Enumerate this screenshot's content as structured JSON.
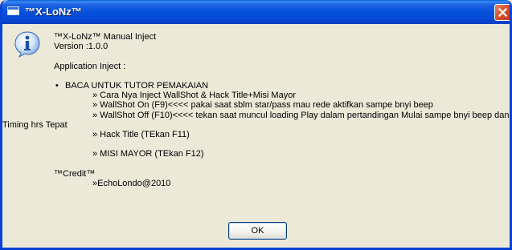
{
  "window": {
    "title": "™X-LoNz™"
  },
  "dialog": {
    "icon": "information-icon",
    "line_title": "™X-LoNz™ Manual Inject",
    "line_version": "Version :1.0.0",
    "line_app": "Application Inject :",
    "bullet": "BACA UNTUK TUTOR PEMAKAIAN",
    "item1": "» Cara Nya Inject WallShot & Hack Title+Misi Mayor",
    "item2": "» WallShot On (F9)<<<< pakai saat sblm star/pass mau rede aktifkan sampe bnyi beep",
    "item3a": "» WallShot Off (F10)<<<< tekan saat muncul loading Play dalam pertandingan Mulai sampe bnyi beep dan",
    "item3b": "Timing hrs Tepat",
    "item4": "» Hack Title (TEkan F11)",
    "item5": "» MISI MAYOR (TEkan F12)",
    "credit_label": "™Credit™",
    "credit_value": "»EchoLondo@2010"
  },
  "buttons": {
    "ok_label": "OK"
  },
  "colors": {
    "titlebar": "#0551dc",
    "close": "#d8542f",
    "dialog_bg": "#ece9d8"
  }
}
